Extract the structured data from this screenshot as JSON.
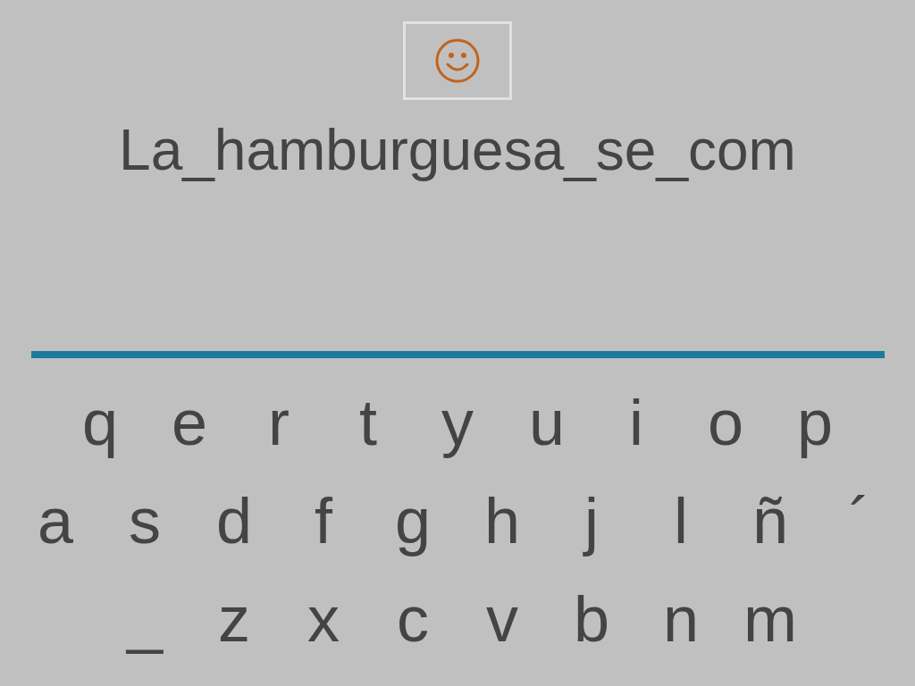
{
  "answer_text": "La_hamburguesa_se_com",
  "keyboard_rows": [
    [
      "q",
      "e",
      "r",
      "t",
      "y",
      "u",
      "i",
      "o",
      "p"
    ],
    [
      "a",
      "s",
      "d",
      "f",
      "g",
      "h",
      "j",
      "l",
      "ñ",
      "´"
    ],
    [
      "_",
      "z",
      "x",
      "c",
      "v",
      "b",
      "n",
      "m"
    ]
  ]
}
